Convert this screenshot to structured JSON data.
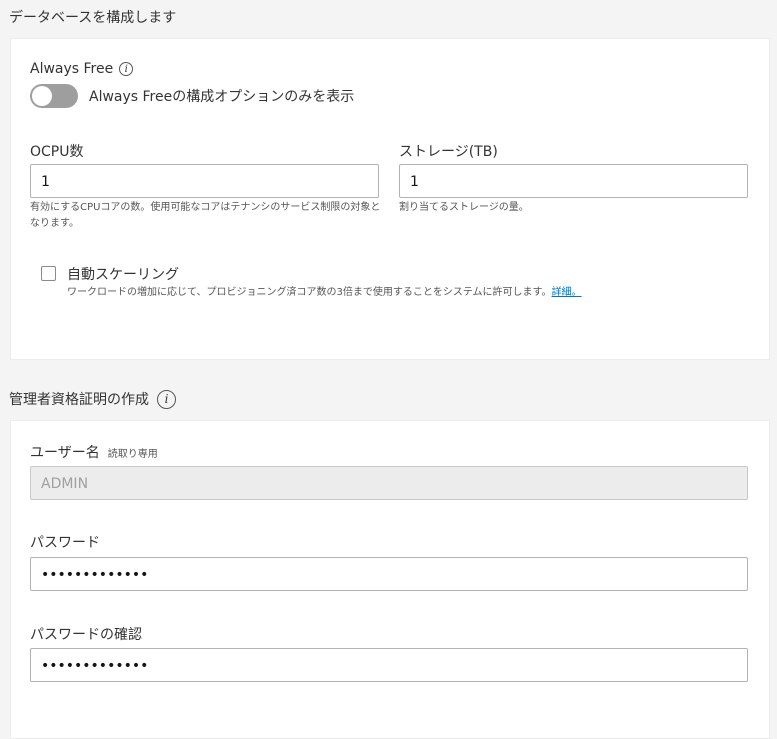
{
  "section1": {
    "title": "データベースを構成します"
  },
  "always_free": {
    "label": "Always Free",
    "toggle_label": "Always Freeの構成オプションのみを表示",
    "toggle_on": false
  },
  "ocpu": {
    "label": "OCPU数",
    "value": "1",
    "help": "有効にするCPUコアの数。使用可能なコアはテナンシのサービス制限の対象となります。"
  },
  "storage": {
    "label": "ストレージ(TB)",
    "value": "1",
    "help": "割り当てるストレージの量。"
  },
  "autoscaling": {
    "label": "自動スケーリング",
    "checked": false,
    "help": "ワークロードの増加に応じて、プロビジョニング済コア数の3倍まで使用することをシステムに許可します。",
    "link": "詳細。"
  },
  "section2": {
    "title": "管理者資格証明の作成"
  },
  "username": {
    "label": "ユーザー名",
    "readonly_tag": "読取り専用",
    "value": "ADMIN"
  },
  "password": {
    "label": "パスワード",
    "value": "•••••••••••••"
  },
  "password_confirm": {
    "label": "パスワードの確認",
    "value": "•••••••••••••"
  },
  "colors": {
    "accent_link": "#0572ce",
    "toggle_off": "#9e9e9e",
    "background": "#f4f4f4"
  }
}
